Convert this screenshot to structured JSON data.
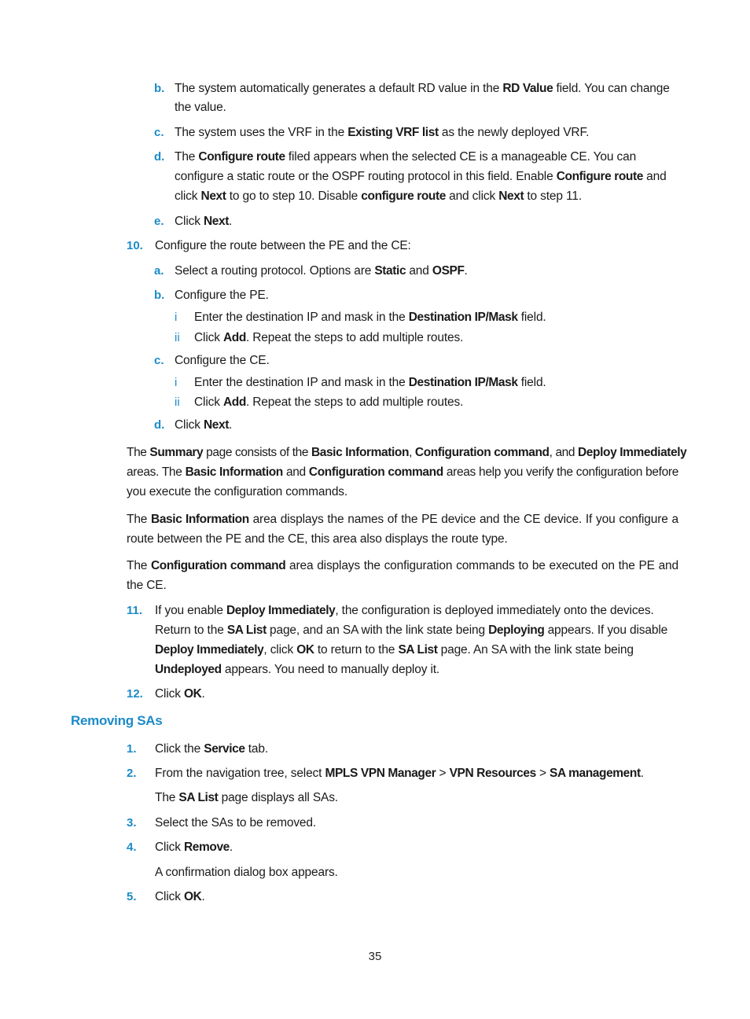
{
  "steps_prev": {
    "b": {
      "label": "b.",
      "lines": [
        [
          "The system automatically generates a default RD value in the ",
          {
            "b": "RD Value"
          },
          " field. You can change"
        ],
        [
          "the value."
        ]
      ]
    },
    "c": {
      "label": "c.",
      "lines": [
        [
          "The system uses the VRF in the ",
          {
            "b": "Existing VRF list"
          },
          " as the newly deployed VRF."
        ]
      ]
    },
    "d": {
      "label": "d.",
      "lines": [
        [
          "The ",
          {
            "b": "Configure route"
          },
          " filed appears when the selected CE is a manageable CE. You can"
        ],
        [
          "configure a static route or the OSPF routing protocol in this field. Enable ",
          {
            "b": "Configure route"
          },
          " and"
        ],
        [
          "click ",
          {
            "b": "Next"
          },
          " to go to step 10. Disable ",
          {
            "b": "configure route"
          },
          " and click ",
          {
            "b": "Next"
          },
          " to step 11."
        ]
      ]
    },
    "e": {
      "label": "e.",
      "lines": [
        [
          "Click ",
          {
            "b": "Next"
          },
          "."
        ]
      ]
    }
  },
  "step10": {
    "label": "10.",
    "text": [
      "Configure the route between the PE and the CE:"
    ],
    "a": {
      "label": "a.",
      "text": [
        "Select a routing protocol. Options are ",
        {
          "b": "Static"
        },
        " and ",
        {
          "b": "OSPF"
        },
        "."
      ]
    },
    "b": {
      "label": "b.",
      "text": [
        "Configure the PE."
      ],
      "i": {
        "label": "i",
        "text": [
          "Enter the destination IP and mask in the ",
          {
            "b": "Destination IP/Mask"
          },
          " field."
        ]
      },
      "ii": {
        "label": "ii",
        "text": [
          "Click ",
          {
            "b": "Add"
          },
          ". Repeat the steps to add multiple routes."
        ]
      }
    },
    "c": {
      "label": "c.",
      "text": [
        "Configure the CE."
      ],
      "i": {
        "label": "i",
        "text": [
          "Enter the destination IP and mask in the ",
          {
            "b": "Destination IP/Mask"
          },
          " field."
        ]
      },
      "ii": {
        "label": "ii",
        "text": [
          "Click ",
          {
            "b": "Add"
          },
          ". Repeat the steps to add multiple routes."
        ]
      }
    },
    "d": {
      "label": "d.",
      "text": [
        "Click ",
        {
          "b": "Next"
        },
        "."
      ]
    }
  },
  "paragraphs": [
    {
      "lines": [
        [
          "The ",
          {
            "b": "Summary"
          },
          " page consists of the ",
          {
            "b": "Basic Information"
          },
          ", ",
          {
            "b": "Configuration command"
          },
          ", and ",
          {
            "b": "Deploy Immediately"
          }
        ],
        [
          "areas. The ",
          {
            "b": "Basic Information"
          },
          " and ",
          {
            "b": "Configuration command"
          },
          " areas help you verify the configuration before"
        ],
        [
          "you execute the configuration commands."
        ]
      ]
    },
    {
      "lines": [
        [
          "The ",
          {
            "b": "Basic Information"
          },
          " area displays the names of the PE device and the CE device. If you configure a"
        ],
        [
          "route between the PE and the CE, this area also displays the route type."
        ]
      ]
    },
    {
      "lines": [
        [
          "The ",
          {
            "b": "Configuration command"
          },
          " area displays the configuration commands to be executed on the PE and"
        ],
        [
          "the CE."
        ]
      ]
    }
  ],
  "step11": {
    "label": "11.",
    "lines": [
      [
        "If you enable ",
        {
          "b": "Deploy Immediately"
        },
        ", the configuration is deployed immediately onto the devices."
      ],
      [
        "Return to the ",
        {
          "b": "SA List"
        },
        " page, and an SA with the link state being ",
        {
          "b": "Deploying"
        },
        " appears. If you disable"
      ],
      [
        {
          "b": "Deploy Immediately"
        },
        ", click ",
        {
          "b": "OK"
        },
        " to return to the ",
        {
          "b": "SA List"
        },
        " page. An SA with the link state being"
      ],
      [
        {
          "b": "Undeployed"
        },
        " appears. You need to manually deploy it."
      ]
    ]
  },
  "step12": {
    "label": "12.",
    "lines": [
      [
        "Click ",
        {
          "b": "OK"
        },
        "."
      ]
    ]
  },
  "section": {
    "heading": "Removing SAs",
    "steps": [
      {
        "label": "1.",
        "lines": [
          [
            "Click the ",
            {
              "b": "Service"
            },
            " tab."
          ]
        ]
      },
      {
        "label": "2.",
        "lines": [
          [
            "From the navigation tree, select ",
            {
              "b": "MPLS VPN Manager"
            },
            " > ",
            {
              "b": "VPN Resources"
            },
            " > ",
            {
              "b": "SA management"
            },
            "."
          ]
        ],
        "note": [
          "The ",
          {
            "b": "SA List"
          },
          " page displays all SAs."
        ]
      },
      {
        "label": "3.",
        "lines": [
          [
            "Select the SAs to be removed."
          ]
        ]
      },
      {
        "label": "4.",
        "lines": [
          [
            "Click ",
            {
              "b": "Remove"
            },
            "."
          ]
        ],
        "note": [
          "A confirmation dialog box appears."
        ]
      },
      {
        "label": "5.",
        "lines": [
          [
            "Click ",
            {
              "b": "OK"
            },
            "."
          ]
        ]
      }
    ]
  },
  "footer": {
    "page_number": "35"
  }
}
